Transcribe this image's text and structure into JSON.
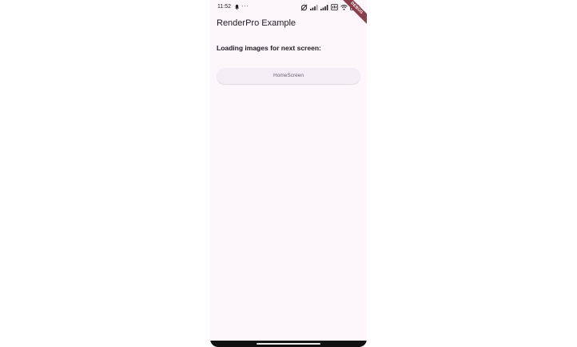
{
  "status_bar": {
    "time": "11:52",
    "more": "···",
    "icons": [
      "bell-icon",
      "more-icon",
      "mute-icon",
      "signal-icon",
      "signal-icon",
      "volte-icon",
      "wifi-icon",
      "battery-icon"
    ]
  },
  "debug_banner": {
    "label": "DEBUG"
  },
  "appbar": {
    "title": "RenderPro Example"
  },
  "content": {
    "loading_label": "Loading images for next screen:",
    "home_button_label": "HomeScreen"
  },
  "colors": {
    "background": "#fdf7fc",
    "button_bg": "#f3edf6",
    "banner": "#8a3f4a"
  }
}
